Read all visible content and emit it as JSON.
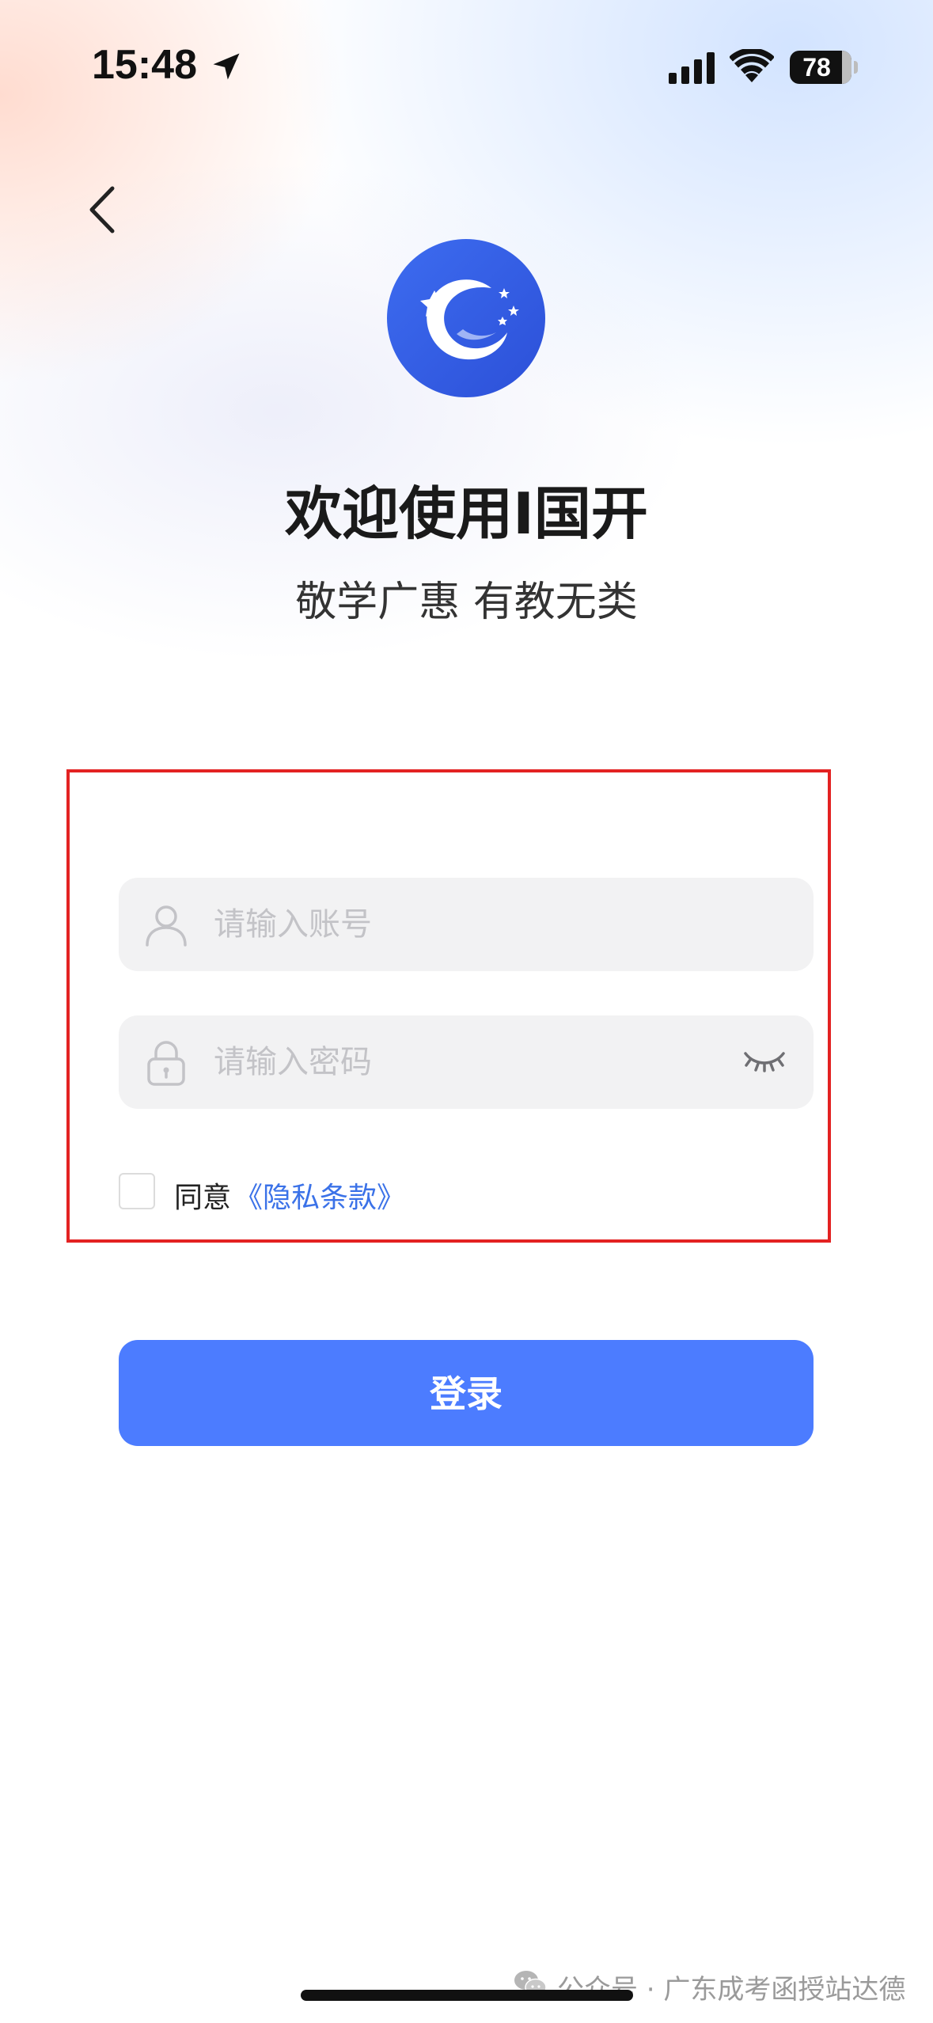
{
  "status_bar": {
    "time": "15:48",
    "battery": "78",
    "icons": [
      "location-arrow-icon",
      "cellular-signal-icon",
      "wifi-icon",
      "battery-icon"
    ]
  },
  "nav": {
    "back_icon": "chevron-left-icon"
  },
  "brand": {
    "logo_icon": "moon-stars-logo-icon",
    "title": "欢迎使用I国开",
    "slogan": "敬学广惠 有教无类"
  },
  "form": {
    "account": {
      "placeholder": "请输入账号",
      "value": "",
      "icon": "user-icon"
    },
    "password": {
      "placeholder": "请输入密码",
      "value": "",
      "icon": "lock-icon",
      "toggle_icon": "eye-closed-icon"
    },
    "agree": {
      "checked": false,
      "label": "同意",
      "link": "《隐私条款》"
    }
  },
  "actions": {
    "login_label": "登录"
  },
  "watermark": {
    "text": "公众号 · 广东成考函授站达德",
    "icon": "wechat-icon"
  },
  "colors": {
    "primary": "#4c7cff",
    "link": "#3b72e8",
    "highlight": "#e32222",
    "field_bg": "#f2f2f3"
  }
}
